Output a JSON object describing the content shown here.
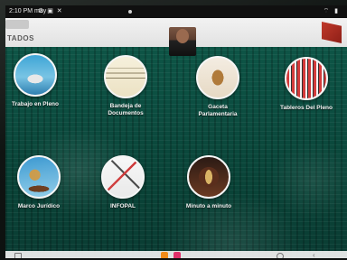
{
  "status_bar": {
    "time": "2:10 PM may",
    "left_icons": "⚙ ▣ ✕",
    "right_icons": "⌔ ▮"
  },
  "header": {
    "brand_text": "TADOS",
    "colors": {
      "background": "#eaeaea",
      "logo": "#c0392b"
    }
  },
  "menu": {
    "row1": [
      {
        "label_line1": "Trabajo en Pleno",
        "label_line2": "",
        "icon": "chamber-photo"
      },
      {
        "label_line1": "Bandeja de",
        "label_line2": "Documentos",
        "icon": "document-page"
      },
      {
        "label_line1": "Gaceta",
        "label_line2": "Parlamentaria",
        "icon": "gazette-book"
      },
      {
        "label_line1": "Tableros Del Pleno",
        "label_line2": "",
        "icon": "voting-board"
      }
    ],
    "row2": [
      {
        "label_line1": "Marco Jurídico",
        "label_line2": "",
        "icon": "gavel"
      },
      {
        "label_line1": "INFOPAL",
        "label_line2": "",
        "icon": "pen-document"
      },
      {
        "label_line1": "Minuto a minuto",
        "label_line2": "",
        "icon": "hourglass"
      }
    ]
  },
  "nav_bar": {
    "dock_colors": [
      "#f08c1a",
      "#e0306a"
    ]
  },
  "colors": {
    "screen_bg": "#0c4e41",
    "label_text": "#f3f3f3"
  }
}
